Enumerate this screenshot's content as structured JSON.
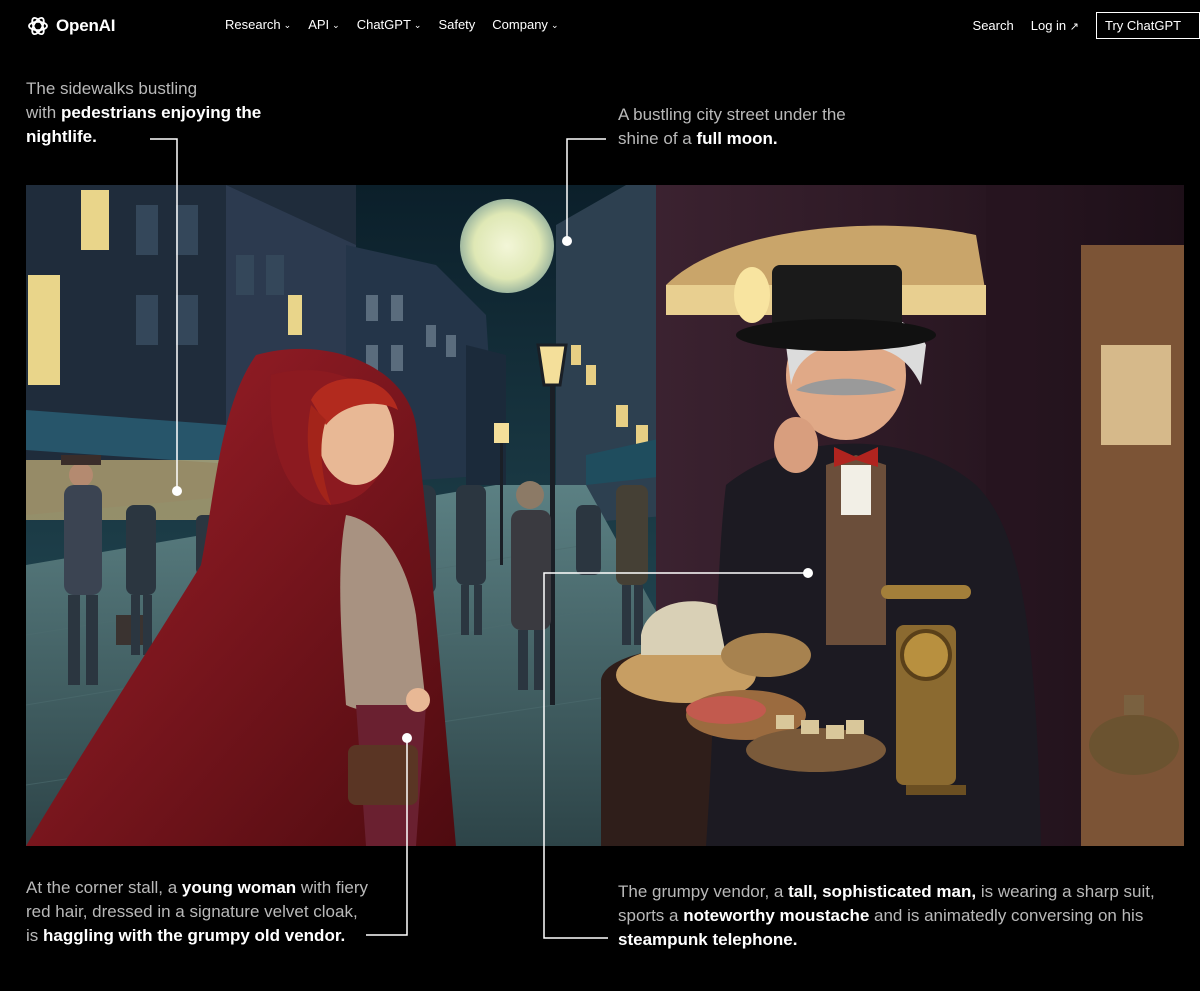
{
  "header": {
    "logo_text": "OpenAI",
    "nav": [
      {
        "label": "Research",
        "has_dropdown": true
      },
      {
        "label": "API",
        "has_dropdown": true
      },
      {
        "label": "ChatGPT",
        "has_dropdown": true
      },
      {
        "label": "Safety",
        "has_dropdown": false
      },
      {
        "label": "Company",
        "has_dropdown": true
      }
    ],
    "search_label": "Search",
    "login_label": "Log in",
    "try_label": "Try ChatGPT",
    "arrow_glyph": "↗",
    "chevron_glyph": "⌄"
  },
  "annotations": {
    "sidewalks": {
      "plain_1": "The sidewalks bustling",
      "plain_2": "with ",
      "bold": "pedestrians enjoying the nightlife."
    },
    "moon": {
      "plain_1": "A bustling city street under the",
      "plain_2": "shine of a ",
      "bold": "full moon."
    },
    "woman": {
      "plain_1": "At the corner stall, a ",
      "bold_1": "young woman",
      "plain_2": " with fiery",
      "plain_3": "red hair, dressed in a signature velvet cloak,",
      "plain_4": "is ",
      "bold_2": "haggling with the grumpy old vendor."
    },
    "vendor": {
      "plain_1": "The grumpy vendor, a ",
      "bold_1": "tall, sophisticated man,",
      "plain_2": " is wearing a sharp suit,",
      "plain_3": "sports a ",
      "bold_2": "noteworthy moustache",
      "plain_4": " and is animatedly conversing on his",
      "bold_3": "steampunk telephone."
    }
  },
  "colors": {
    "background": "#000000",
    "caption_gray": "#b9b9b9",
    "text_white": "#ffffff",
    "cloak_red": "#7a1418",
    "night_sky": "#0f2a33",
    "moon": "#e8efc4"
  }
}
